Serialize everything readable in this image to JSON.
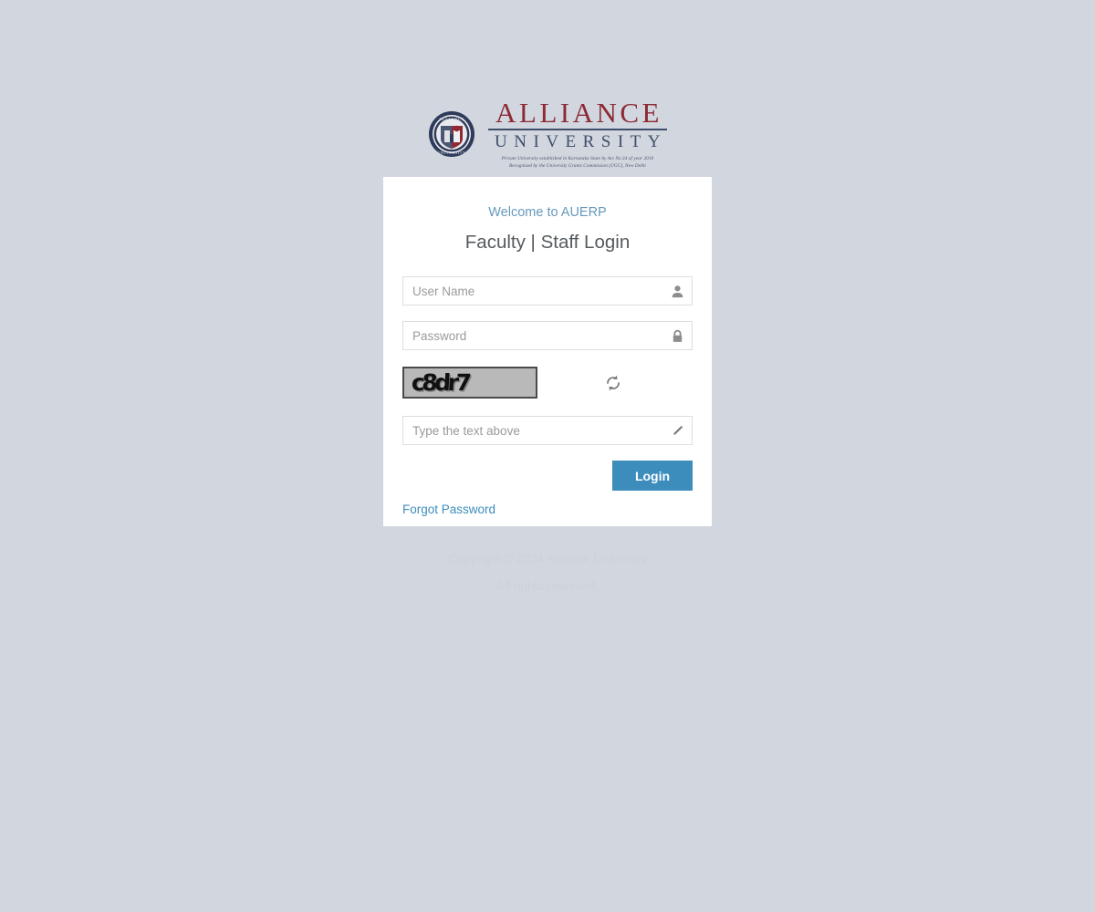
{
  "brand": {
    "seal_icon": "alliance-university-seal",
    "name_main": "ALLIANCE",
    "name_sub": "UNIVERSITY",
    "tagline_line1": "Private University established in Karnataka State by Act No.34 of year 2010",
    "tagline_line2": "Recognized by the University Grants Commission (UGC), New Delhi",
    "colors": {
      "main": "#8d2a35",
      "sub": "#3f4e6b"
    }
  },
  "card": {
    "welcome": "Welcome to AUERP",
    "title": "Faculty | Staff Login",
    "username": {
      "placeholder": "User Name",
      "value": "",
      "icon": "user-icon"
    },
    "password": {
      "placeholder": "Password",
      "value": "",
      "icon": "lock-icon"
    },
    "captcha": {
      "text": "c8dr7",
      "refresh_icon": "refresh-icon",
      "input_placeholder": "Type the text above",
      "input_value": "",
      "input_icon": "pencil-icon"
    },
    "login_button": "Login",
    "forgot_link": "Forgot Password",
    "accent_color": "#3c8dbc"
  },
  "footer": {
    "line1": "Copyright © 2024 Alliance University",
    "line2": "All rights reserved."
  }
}
